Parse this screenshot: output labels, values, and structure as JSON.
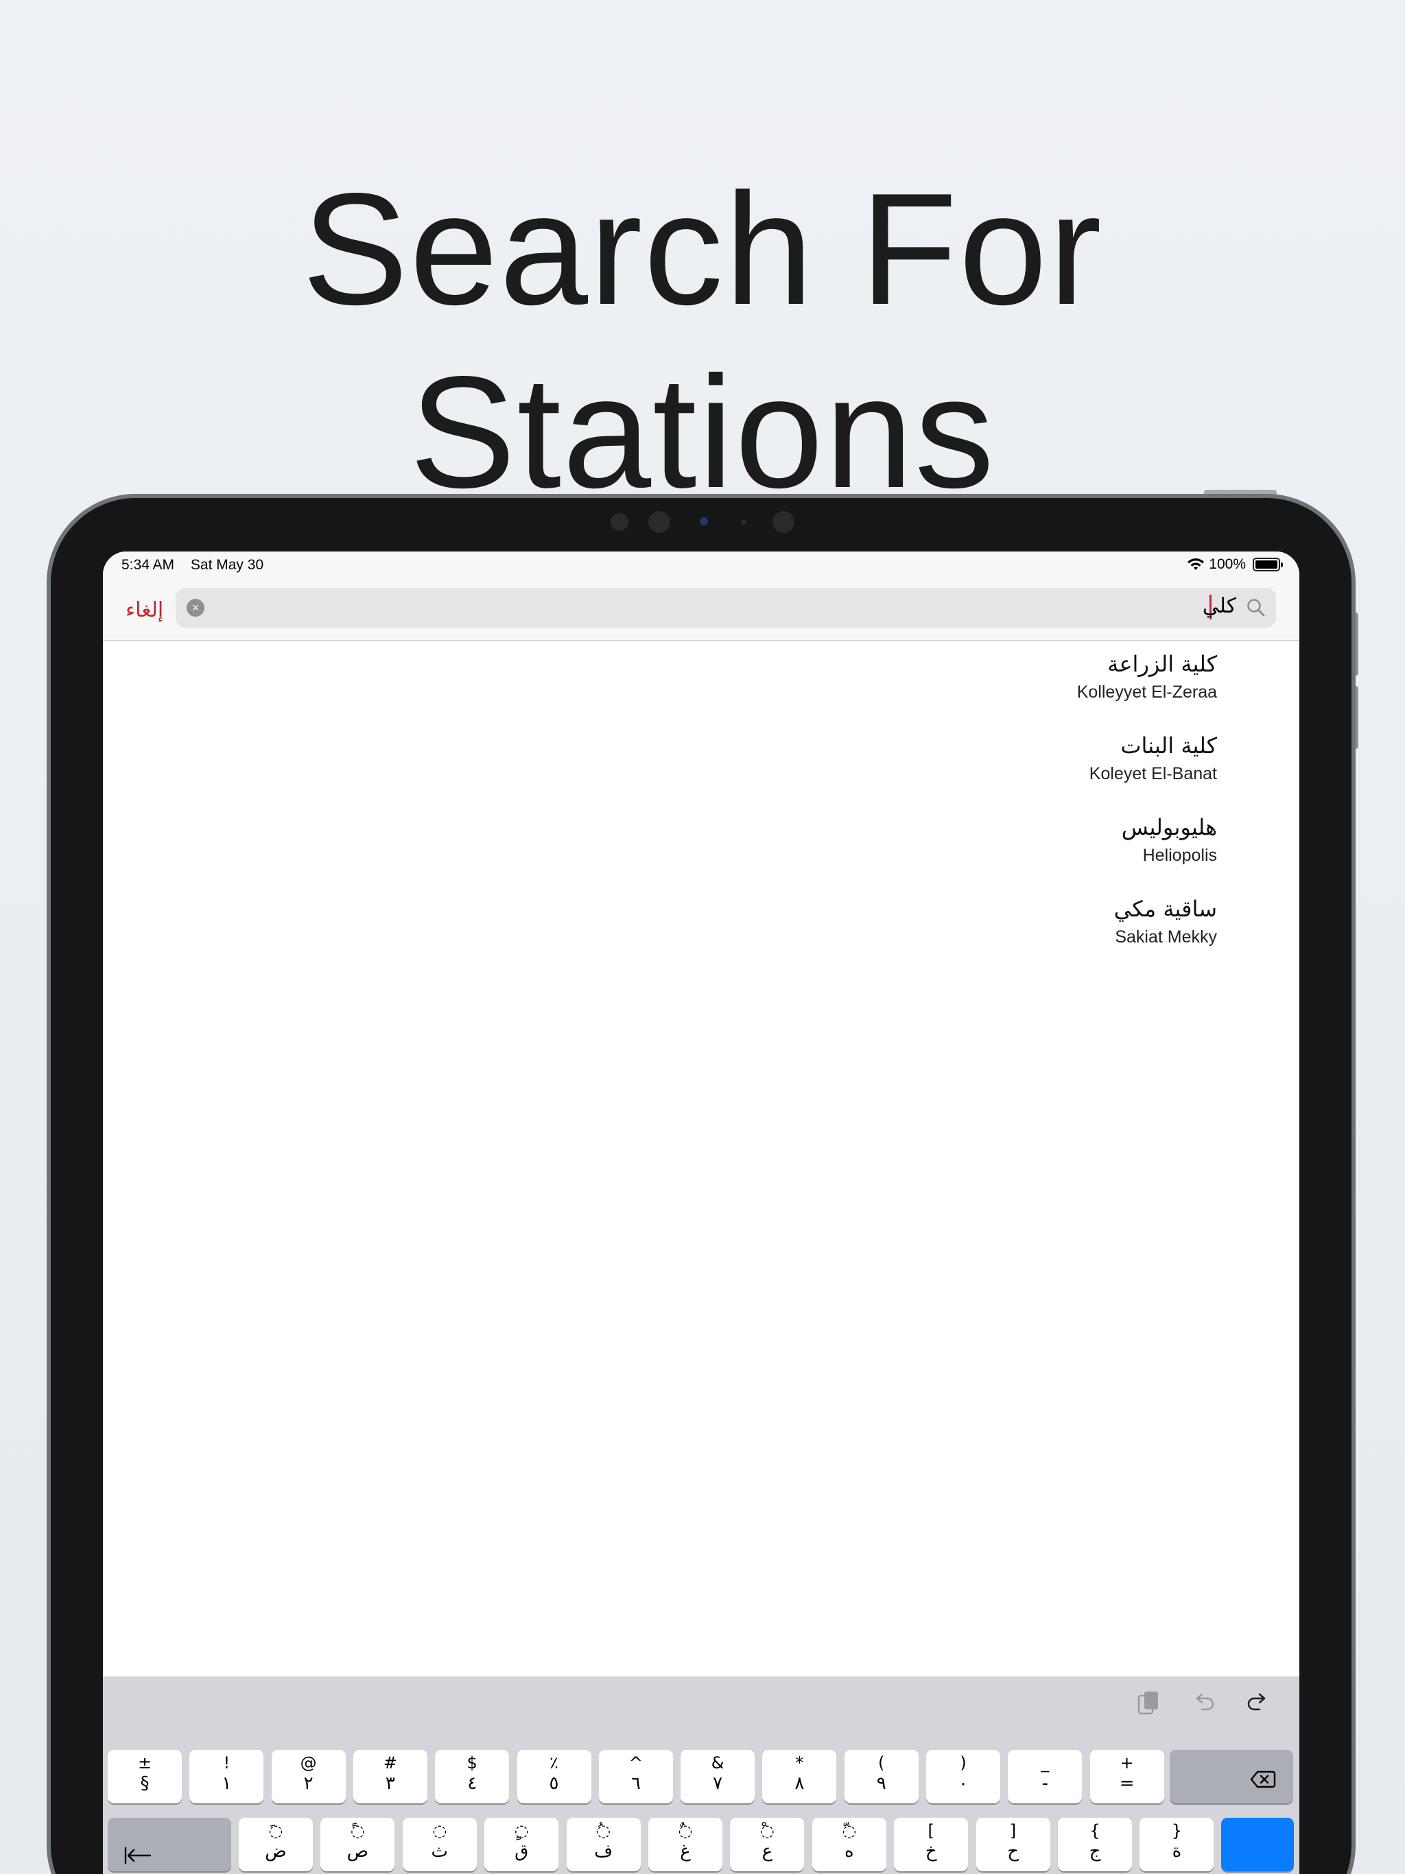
{
  "headline": "Search For Stations",
  "status_bar": {
    "time": "5:34 AM",
    "date": "Sat May 30",
    "battery": "100%"
  },
  "nav": {
    "cancel_label": "إلغاء",
    "search_value": "كلي"
  },
  "results": [
    {
      "arabic": "كلية الزراعة",
      "english": "Kolleyyet El-Zeraa"
    },
    {
      "arabic": "كلية البنات",
      "english": "Koleyet El-Banat"
    },
    {
      "arabic": "هليوبوليس",
      "english": "Heliopolis"
    },
    {
      "arabic": "ساقية مكي",
      "english": "Sakiat Mekky"
    }
  ],
  "keyboard": {
    "row1": [
      {
        "top": "±",
        "bot": "§"
      },
      {
        "top": "!",
        "bot": "١"
      },
      {
        "top": "@",
        "bot": "٢"
      },
      {
        "top": "#",
        "bot": "٣"
      },
      {
        "top": "$",
        "bot": "٤"
      },
      {
        "top": "٪",
        "bot": "٥"
      },
      {
        "top": "^",
        "bot": "٦"
      },
      {
        "top": "&",
        "bot": "٧"
      },
      {
        "top": "*",
        "bot": "٨"
      },
      {
        "top": "(",
        "bot": "٩"
      },
      {
        "top": ")",
        "bot": "٠"
      },
      {
        "top": "_",
        "bot": "-"
      },
      {
        "top": "+",
        "bot": "="
      }
    ],
    "row2": [
      {
        "top": "◌َ",
        "bot": "ض"
      },
      {
        "top": "◌ً",
        "bot": "ص"
      },
      {
        "top": "◌",
        "bot": "ث"
      },
      {
        "top": "◌ٍ",
        "bot": "ق"
      },
      {
        "top": "◌ُ",
        "bot": "ف"
      },
      {
        "top": "◌ٌ",
        "bot": "غ"
      },
      {
        "top": "◌ْ",
        "bot": "ع"
      },
      {
        "top": "◌ّ",
        "bot": "ه"
      },
      {
        "top": "[",
        "bot": "خ"
      },
      {
        "top": "]",
        "bot": "ح"
      },
      {
        "top": "{",
        "bot": "ج"
      },
      {
        "top": "}",
        "bot": "ة"
      }
    ]
  },
  "colors": {
    "accent": "#c3272b",
    "keyboard_bg": "#d4d5da",
    "return_key": "#0a7cff"
  }
}
